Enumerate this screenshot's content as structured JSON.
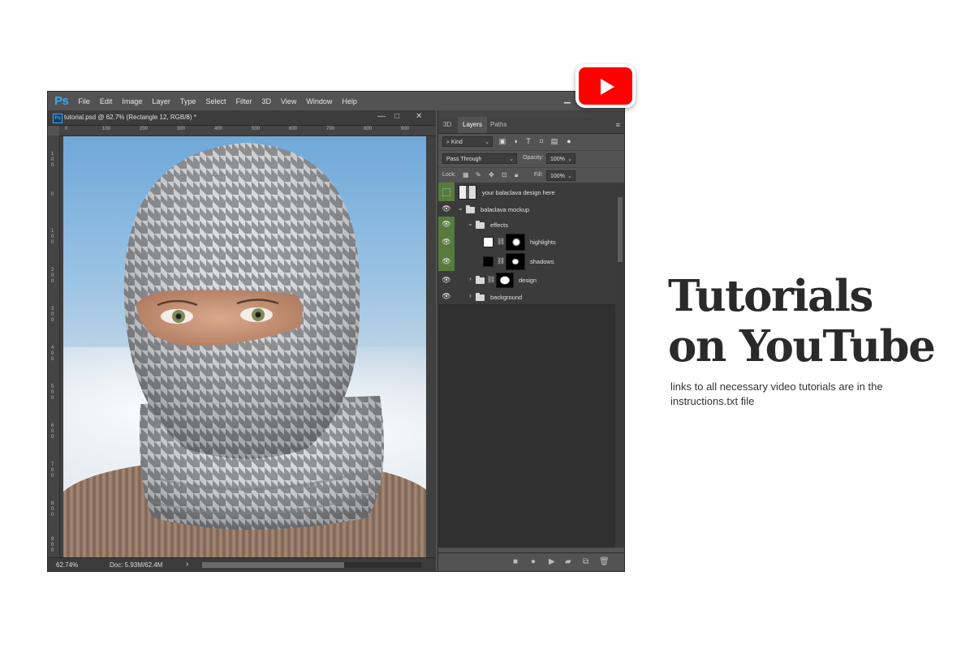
{
  "app": {
    "logo": "Ps",
    "menu": [
      "File",
      "Edit",
      "Image",
      "Layer",
      "Type",
      "Select",
      "Filter",
      "3D",
      "View",
      "Window",
      "Help"
    ]
  },
  "document": {
    "tab_icon": "Ps",
    "tab_title": "tutorial.psd @ 62.7% (Rectangle 12, RGB/8) *",
    "ruler_top_ticks": [
      "0",
      "100",
      "200",
      "300",
      "400",
      "500",
      "600",
      "700",
      "800",
      "900"
    ],
    "ruler_left_ticks": [
      "1\n0\n0",
      "0",
      "1\n0\n0",
      "2\n0\n0",
      "3\n0\n0",
      "4\n0\n0",
      "5\n0\n0",
      "6\n0\n0",
      "7\n0\n0",
      "8\n0\n0",
      "9\n0\n0"
    ],
    "zoom": "62.74%",
    "doc_size": "Doc: 5.93M/62.4M",
    "status_arrow": "›"
  },
  "panel": {
    "tabs": [
      "3D",
      "Layers",
      "Paths"
    ],
    "active_tab": "Layers",
    "filter_kind": "Kind",
    "blend_mode": "Pass Through",
    "opacity_label": "Opacity:",
    "opacity_value": "100%",
    "lock_label": "Lock:",
    "fill_label": "Fill:",
    "fill_value": "100%",
    "layers": [
      {
        "name": "your balaclava design here",
        "visible": false,
        "type": "smart-object"
      },
      {
        "name": "balaclava mockup",
        "visible": true,
        "type": "group"
      },
      {
        "name": "effects",
        "visible": true,
        "type": "group"
      },
      {
        "name": "highlights",
        "visible": true,
        "type": "adjustment"
      },
      {
        "name": "shadows",
        "visible": true,
        "type": "adjustment"
      },
      {
        "name": "design",
        "visible": true,
        "type": "group"
      },
      {
        "name": "background",
        "visible": true,
        "type": "group"
      }
    ]
  },
  "promo": {
    "headline_line1": "Tutorials",
    "headline_line2": "on YouTube",
    "subtext": "links to all necessary video tutorials are in the instructions.txt file"
  },
  "colors": {
    "youtube_red": "#ff0000",
    "ps_blue": "#31a8ff",
    "eye_green": "#577b3f"
  }
}
